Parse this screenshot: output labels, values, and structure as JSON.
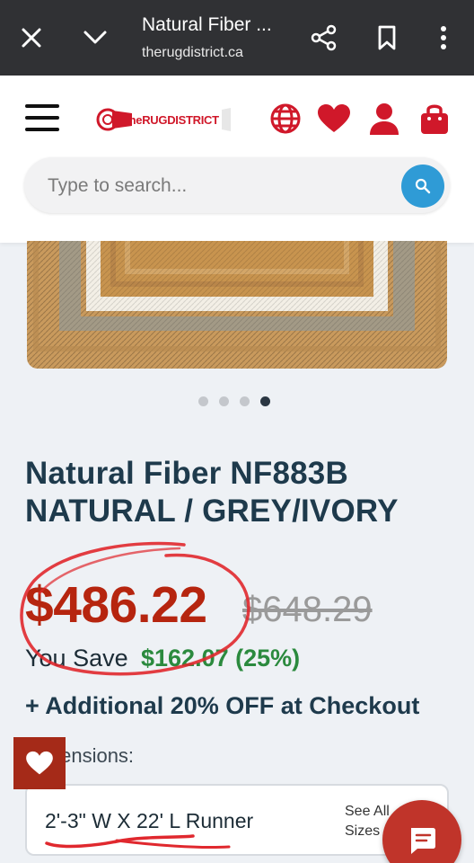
{
  "browser": {
    "title": "Natural Fiber ...",
    "url": "therugdistrict.ca",
    "icons": [
      "close-icon",
      "chevron-down-icon",
      "share-icon",
      "bookmark-icon",
      "more-vert-icon"
    ]
  },
  "site": {
    "logo_text": {
      "prefix": "The",
      "mid": "RUG",
      "suffix": "DISTRICT"
    },
    "header_icons": [
      "globe-icon",
      "heart-icon",
      "user-icon",
      "bag-icon"
    ],
    "accent_color": "#d0182a"
  },
  "search": {
    "placeholder": "Type to search..."
  },
  "carousel": {
    "count": 4,
    "active": 4
  },
  "product": {
    "title": "Natural Fiber NF883B NATURAL / GREY/IVORY",
    "price": "$486.22",
    "old_price": "$648.29",
    "you_save_label": "You Save",
    "you_save_amount": "$162.07 (25%)",
    "promo": "+ Additional 20% OFF at Checkout",
    "dimensions_label": "Dimensions:",
    "selected_size": "2'-3\" W X 22' L Runner",
    "see_all_sizes": "See All Sizes"
  },
  "colors": {
    "price": "#b6250f",
    "save": "#2b8a3e",
    "title": "#1e3a4c",
    "annotation": "#e0282e"
  }
}
